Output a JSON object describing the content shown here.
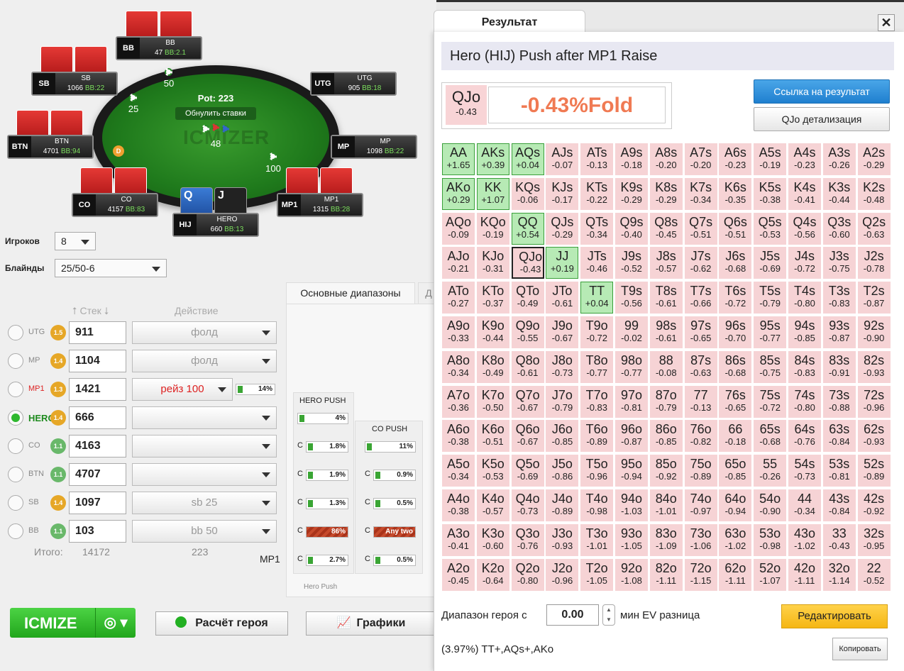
{
  "table": {
    "pot_label": "Pot: 223",
    "reset_label": "Обнулить ставки",
    "watermark": "ICMIZER",
    "chip_values": [
      "50",
      "25",
      "48",
      "100"
    ],
    "dealer": "D",
    "seats": [
      {
        "pos": "BB",
        "name": "BB",
        "stack": "47",
        "bb": "BB:2.1"
      },
      {
        "pos": "SB",
        "name": "SB",
        "stack": "1066",
        "bb": "BB:22"
      },
      {
        "pos": "UTG",
        "name": "UTG",
        "stack": "905",
        "bb": "BB:18"
      },
      {
        "pos": "BTN",
        "name": "BTN",
        "stack": "4701",
        "bb": "BB:94"
      },
      {
        "pos": "MP",
        "name": "MP",
        "stack": "1098",
        "bb": "BB:22"
      },
      {
        "pos": "CO",
        "name": "CO",
        "stack": "4157",
        "bb": "BB:83"
      },
      {
        "pos": "MP1",
        "name": "MP1",
        "stack": "1315",
        "bb": "BB:28"
      },
      {
        "pos": "HIJ",
        "name": "HERO",
        "stack": "660",
        "bb": "BB:13"
      }
    ],
    "hero_cards": [
      "Q",
      "J"
    ]
  },
  "settings": {
    "players_label": "Игроков",
    "players_value": "8",
    "blinds_label": "Блайнды",
    "blinds_value": "25/50-6"
  },
  "players_table": {
    "stack_header": "Стек",
    "action_header": "Действие",
    "rows": [
      {
        "name": "UTG",
        "badge": "1.5",
        "badge_color": "#e6a727",
        "stack": "911",
        "action": "фолд"
      },
      {
        "name": "MP",
        "badge": "1.4",
        "badge_color": "#e6a727",
        "stack": "1104",
        "action": "фолд"
      },
      {
        "name": "MP1",
        "badge": "1.3",
        "badge_color": "#e6a727",
        "stack": "1421",
        "action": "рейз 100",
        "pct": "14%"
      },
      {
        "name": "HERO",
        "badge": "1.4",
        "badge_color": "#e6a727",
        "stack": "666",
        "action": ""
      },
      {
        "name": "CO",
        "badge": "1.1",
        "badge_color": "#69b86a",
        "stack": "4163",
        "action": ""
      },
      {
        "name": "BTN",
        "badge": "1.1",
        "badge_color": "#69b86a",
        "stack": "4707",
        "action": ""
      },
      {
        "name": "SB",
        "badge": "1.4",
        "badge_color": "#e6a727",
        "stack": "1097",
        "action": "sb 25"
      },
      {
        "name": "BB",
        "badge": "1.1",
        "badge_color": "#69b86a",
        "stack": "103",
        "action": "bb 50"
      }
    ],
    "total_label": "Итого:",
    "total_stack": "14172",
    "total_action": "223",
    "footer_pos": "MP1"
  },
  "ranges": {
    "tab_main": "Основные диапазоны",
    "tab_other": "Д",
    "hero_push_title": "HERO PUSH",
    "hero_push_pct": "4%",
    "hero_calls": [
      "1.8%",
      "1.9%",
      "1.3%",
      "86%",
      "2.7%"
    ],
    "co_push_title": "CO PUSH",
    "co_push_pct": "11%",
    "co_calls": [
      "0.9%",
      "0.5%",
      "Any two",
      "0.5%"
    ],
    "call_letter": "C",
    "footer_label": "Hero Push"
  },
  "buttons": {
    "icmize": "ICMIZE",
    "hero_calc": "Расчёт героя",
    "charts": "Графики"
  },
  "result": {
    "tab_label": "Результат",
    "title": "Hero (HIJ) Push after MP1 Raise",
    "hand": "QJo",
    "hand_value": "-0.43",
    "hand_ev": "-0.43%Fold",
    "link_button": "Ссылка на результат",
    "detail_button": "QJo детализация",
    "min_ev_label": "Диапазон героя с",
    "min_ev_value": "0.00",
    "min_ev_suffix": "мин EV разница",
    "edit_button": "Редактировать",
    "summary": "(3.97%) TT+,AQs+,AKo",
    "copy_button": "Копировать",
    "grid": [
      [
        [
          "AA",
          "+1.65"
        ],
        [
          "AKs",
          "+0.39"
        ],
        [
          "AQs",
          "+0.04"
        ],
        [
          "AJs",
          "-0.07"
        ],
        [
          "ATs",
          "-0.13"
        ],
        [
          "A9s",
          "-0.18"
        ],
        [
          "A8s",
          "-0.20"
        ],
        [
          "A7s",
          "-0.20"
        ],
        [
          "A6s",
          "-0.23"
        ],
        [
          "A5s",
          "-0.19"
        ],
        [
          "A4s",
          "-0.23"
        ],
        [
          "A3s",
          "-0.26"
        ],
        [
          "A2s",
          "-0.29"
        ]
      ],
      [
        [
          "AKo",
          "+0.29"
        ],
        [
          "KK",
          "+1.07"
        ],
        [
          "KQs",
          "-0.06"
        ],
        [
          "KJs",
          "-0.17"
        ],
        [
          "KTs",
          "-0.22"
        ],
        [
          "K9s",
          "-0.29"
        ],
        [
          "K8s",
          "-0.29"
        ],
        [
          "K7s",
          "-0.34"
        ],
        [
          "K6s",
          "-0.35"
        ],
        [
          "K5s",
          "-0.38"
        ],
        [
          "K4s",
          "-0.41"
        ],
        [
          "K3s",
          "-0.44"
        ],
        [
          "K2s",
          "-0.48"
        ]
      ],
      [
        [
          "AQo",
          "-0.09"
        ],
        [
          "KQo",
          "-0.19"
        ],
        [
          "QQ",
          "+0.54"
        ],
        [
          "QJs",
          "-0.29"
        ],
        [
          "QTs",
          "-0.34"
        ],
        [
          "Q9s",
          "-0.40"
        ],
        [
          "Q8s",
          "-0.45"
        ],
        [
          "Q7s",
          "-0.51"
        ],
        [
          "Q6s",
          "-0.51"
        ],
        [
          "Q5s",
          "-0.53"
        ],
        [
          "Q4s",
          "-0.56"
        ],
        [
          "Q3s",
          "-0.60"
        ],
        [
          "Q2s",
          "-0.63"
        ]
      ],
      [
        [
          "AJo",
          "-0.21"
        ],
        [
          "KJo",
          "-0.31"
        ],
        [
          "QJo",
          "-0.43"
        ],
        [
          "JJ",
          "+0.19"
        ],
        [
          "JTs",
          "-0.46"
        ],
        [
          "J9s",
          "-0.52"
        ],
        [
          "J8s",
          "-0.57"
        ],
        [
          "J7s",
          "-0.62"
        ],
        [
          "J6s",
          "-0.68"
        ],
        [
          "J5s",
          "-0.69"
        ],
        [
          "J4s",
          "-0.72"
        ],
        [
          "J3s",
          "-0.75"
        ],
        [
          "J2s",
          "-0.78"
        ]
      ],
      [
        [
          "ATo",
          "-0.27"
        ],
        [
          "KTo",
          "-0.37"
        ],
        [
          "QTo",
          "-0.49"
        ],
        [
          "JTo",
          "-0.61"
        ],
        [
          "TT",
          "+0.04"
        ],
        [
          "T9s",
          "-0.56"
        ],
        [
          "T8s",
          "-0.61"
        ],
        [
          "T7s",
          "-0.66"
        ],
        [
          "T6s",
          "-0.72"
        ],
        [
          "T5s",
          "-0.79"
        ],
        [
          "T4s",
          "-0.80"
        ],
        [
          "T3s",
          "-0.83"
        ],
        [
          "T2s",
          "-0.87"
        ]
      ],
      [
        [
          "A9o",
          "-0.33"
        ],
        [
          "K9o",
          "-0.44"
        ],
        [
          "Q9o",
          "-0.55"
        ],
        [
          "J9o",
          "-0.67"
        ],
        [
          "T9o",
          "-0.72"
        ],
        [
          "99",
          "-0.02"
        ],
        [
          "98s",
          "-0.61"
        ],
        [
          "97s",
          "-0.65"
        ],
        [
          "96s",
          "-0.70"
        ],
        [
          "95s",
          "-0.77"
        ],
        [
          "94s",
          "-0.85"
        ],
        [
          "93s",
          "-0.87"
        ],
        [
          "92s",
          "-0.90"
        ]
      ],
      [
        [
          "A8o",
          "-0.34"
        ],
        [
          "K8o",
          "-0.49"
        ],
        [
          "Q8o",
          "-0.61"
        ],
        [
          "J8o",
          "-0.73"
        ],
        [
          "T8o",
          "-0.77"
        ],
        [
          "98o",
          "-0.77"
        ],
        [
          "88",
          "-0.08"
        ],
        [
          "87s",
          "-0.63"
        ],
        [
          "86s",
          "-0.68"
        ],
        [
          "85s",
          "-0.75"
        ],
        [
          "84s",
          "-0.83"
        ],
        [
          "83s",
          "-0.91"
        ],
        [
          "82s",
          "-0.93"
        ]
      ],
      [
        [
          "A7o",
          "-0.36"
        ],
        [
          "K7o",
          "-0.50"
        ],
        [
          "Q7o",
          "-0.67"
        ],
        [
          "J7o",
          "-0.79"
        ],
        [
          "T7o",
          "-0.83"
        ],
        [
          "97o",
          "-0.81"
        ],
        [
          "87o",
          "-0.79"
        ],
        [
          "77",
          "-0.13"
        ],
        [
          "76s",
          "-0.65"
        ],
        [
          "75s",
          "-0.72"
        ],
        [
          "74s",
          "-0.80"
        ],
        [
          "73s",
          "-0.88"
        ],
        [
          "72s",
          "-0.96"
        ]
      ],
      [
        [
          "A6o",
          "-0.38"
        ],
        [
          "K6o",
          "-0.51"
        ],
        [
          "Q6o",
          "-0.67"
        ],
        [
          "J6o",
          "-0.85"
        ],
        [
          "T6o",
          "-0.89"
        ],
        [
          "96o",
          "-0.87"
        ],
        [
          "86o",
          "-0.85"
        ],
        [
          "76o",
          "-0.82"
        ],
        [
          "66",
          "-0.18"
        ],
        [
          "65s",
          "-0.68"
        ],
        [
          "64s",
          "-0.76"
        ],
        [
          "63s",
          "-0.84"
        ],
        [
          "62s",
          "-0.93"
        ]
      ],
      [
        [
          "A5o",
          "-0.34"
        ],
        [
          "K5o",
          "-0.53"
        ],
        [
          "Q5o",
          "-0.69"
        ],
        [
          "J5o",
          "-0.86"
        ],
        [
          "T5o",
          "-0.96"
        ],
        [
          "95o",
          "-0.94"
        ],
        [
          "85o",
          "-0.92"
        ],
        [
          "75o",
          "-0.89"
        ],
        [
          "65o",
          "-0.85"
        ],
        [
          "55",
          "-0.26"
        ],
        [
          "54s",
          "-0.73"
        ],
        [
          "53s",
          "-0.81"
        ],
        [
          "52s",
          "-0.89"
        ]
      ],
      [
        [
          "A4o",
          "-0.38"
        ],
        [
          "K4o",
          "-0.57"
        ],
        [
          "Q4o",
          "-0.73"
        ],
        [
          "J4o",
          "-0.89"
        ],
        [
          "T4o",
          "-0.98"
        ],
        [
          "94o",
          "-1.03"
        ],
        [
          "84o",
          "-1.01"
        ],
        [
          "74o",
          "-0.97"
        ],
        [
          "64o",
          "-0.94"
        ],
        [
          "54o",
          "-0.90"
        ],
        [
          "44",
          "-0.34"
        ],
        [
          "43s",
          "-0.84"
        ],
        [
          "42s",
          "-0.92"
        ]
      ],
      [
        [
          "A3o",
          "-0.41"
        ],
        [
          "K3o",
          "-0.60"
        ],
        [
          "Q3o",
          "-0.76"
        ],
        [
          "J3o",
          "-0.93"
        ],
        [
          "T3o",
          "-1.01"
        ],
        [
          "93o",
          "-1.05"
        ],
        [
          "83o",
          "-1.09"
        ],
        [
          "73o",
          "-1.06"
        ],
        [
          "63o",
          "-1.02"
        ],
        [
          "53o",
          "-0.98"
        ],
        [
          "43o",
          "-1.02"
        ],
        [
          "33",
          "-0.43"
        ],
        [
          "32s",
          "-0.95"
        ]
      ],
      [
        [
          "A2o",
          "-0.45"
        ],
        [
          "K2o",
          "-0.64"
        ],
        [
          "Q2o",
          "-0.80"
        ],
        [
          "J2o",
          "-0.96"
        ],
        [
          "T2o",
          "-1.05"
        ],
        [
          "92o",
          "-1.08"
        ],
        [
          "82o",
          "-1.11"
        ],
        [
          "72o",
          "-1.15"
        ],
        [
          "62o",
          "-1.11"
        ],
        [
          "52o",
          "-1.07"
        ],
        [
          "42o",
          "-1.11"
        ],
        [
          "32o",
          "-1.14"
        ],
        [
          "22",
          "-0.52"
        ]
      ]
    ],
    "selected_hand": "QJo",
    "colors": {
      "positive": "#b7eab5",
      "negative": "#f6d3d5",
      "ev_text": "#f07a53"
    }
  }
}
